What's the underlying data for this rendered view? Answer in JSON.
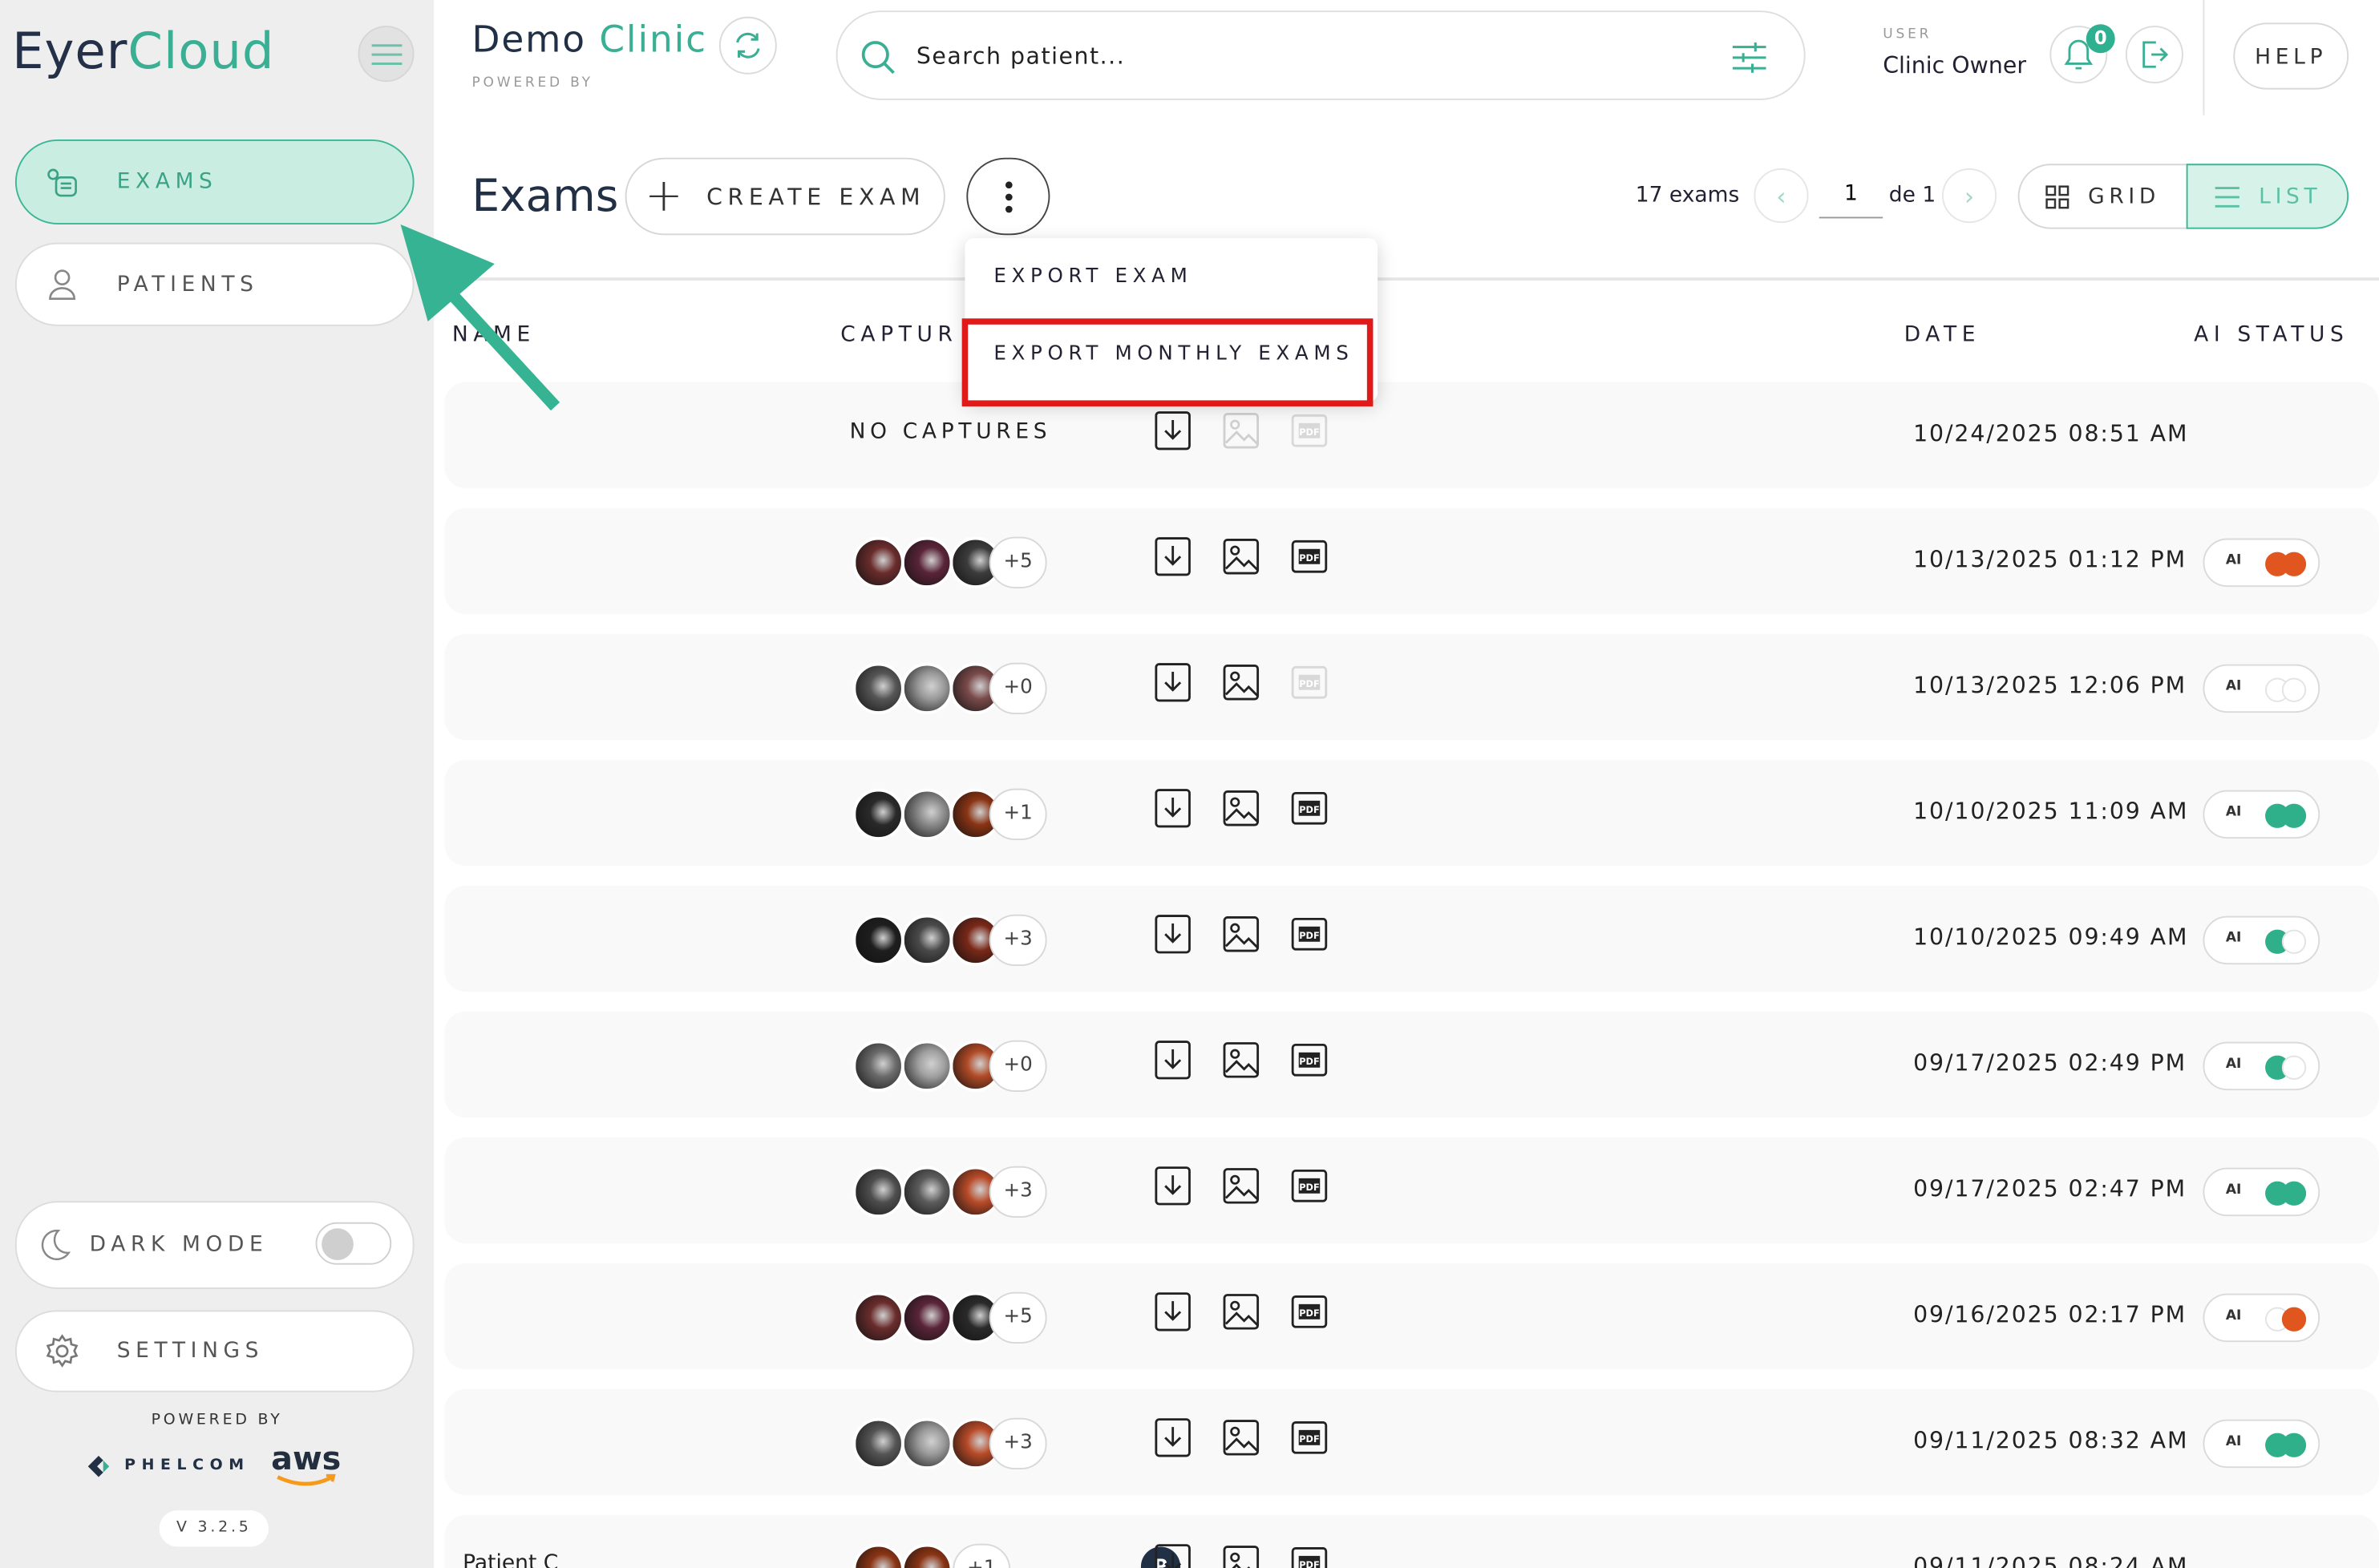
{
  "app": {
    "logo_part1": "Eyer",
    "logo_part2": "Cloud",
    "version": "V 3.2.5",
    "powered_by": "POWERED BY",
    "partner1": "PHELCOM",
    "partner2": "aws"
  },
  "sidebar": {
    "items": [
      {
        "label": "EXAMS",
        "icon": "exams-icon",
        "active": true
      },
      {
        "label": "PATIENTS",
        "icon": "person-icon",
        "active": false
      }
    ],
    "dark_mode_label": "DARK MODE",
    "dark_mode_on": false,
    "settings_label": "SETTINGS"
  },
  "header": {
    "clinic_part1": "Demo",
    "clinic_part2": "Clinic",
    "clinic_sub": "POWERED BY",
    "search_placeholder": "Search patient...",
    "user_label": "USER",
    "user_name": "Clinic Owner",
    "notifications": "0",
    "help_label": "HELP"
  },
  "toolbar": {
    "title": "Exams",
    "create_label": "CREATE EXAM",
    "count_label": "17 exams",
    "page_value": "1",
    "page_of": "de 1",
    "grid_label": "GRID",
    "list_label": "LIST"
  },
  "dropdown": {
    "items": [
      "EXPORT EXAM",
      "EXPORT MONTHLY EXAMS"
    ],
    "highlighted_index": 1
  },
  "table": {
    "headers": {
      "name": "NAME",
      "captures": "CAPTUR",
      "date": "DATE",
      "ai_status": "AI STATUS"
    },
    "rows": [
      {
        "name": "",
        "captures": "NO CAPTURES",
        "extra": "",
        "pdf": false,
        "image": false,
        "date": "10/24/2025 08:51 AM",
        "ai": null
      },
      {
        "name": "",
        "captures": "",
        "extra": "+5",
        "thumbs": [
          "#6a2c2c",
          "#5a2438",
          "#3c3c3c"
        ],
        "pdf": true,
        "image": true,
        "date": "10/13/2025 01:12 PM",
        "ai": {
          "label": "AI",
          "dots": [
            "#e0561e",
            "#e0561e"
          ]
        }
      },
      {
        "name": "",
        "captures": "",
        "extra": "+0",
        "thumbs": [
          "#555555",
          "#9a9a9a",
          "#7a4a4a"
        ],
        "pdf": false,
        "image": true,
        "date": "10/13/2025 12:06 PM",
        "ai": {
          "label": "AI",
          "dots": [
            "none",
            "none"
          ]
        }
      },
      {
        "name": "",
        "captures": "",
        "extra": "+1",
        "thumbs": [
          "#2a2a2a",
          "#8a8a8a",
          "#8a3414"
        ],
        "pdf": true,
        "image": true,
        "date": "10/10/2025 11:09 AM",
        "ai": {
          "label": "AI",
          "dots": [
            "#2fb08a",
            "#2fb08a"
          ]
        }
      },
      {
        "name": "",
        "captures": "",
        "extra": "+3",
        "thumbs": [
          "#1e1e1e",
          "#4a4a4a",
          "#7a2818"
        ],
        "pdf": true,
        "image": true,
        "date": "10/10/2025 09:49 AM",
        "ai": {
          "label": "AI",
          "dots": [
            "#2fb08a",
            "none"
          ]
        }
      },
      {
        "name": "",
        "captures": "",
        "extra": "+0",
        "thumbs": [
          "#6a6a6a",
          "#a0a0a0",
          "#b04a26"
        ],
        "pdf": true,
        "image": true,
        "date": "09/17/2025 02:49 PM",
        "ai": {
          "label": "AI",
          "dots": [
            "#2fb08a",
            "none"
          ]
        }
      },
      {
        "name": "",
        "captures": "",
        "extra": "+3",
        "thumbs": [
          "#4e4e4e",
          "#5c5c5c",
          "#b84a28"
        ],
        "pdf": true,
        "image": true,
        "date": "09/17/2025 02:47 PM",
        "ai": {
          "label": "AI",
          "dots": [
            "#2fb08a",
            "#2fb08a"
          ]
        }
      },
      {
        "name": "",
        "captures": "",
        "extra": "+5",
        "thumbs": [
          "#6a2c2c",
          "#5a2438",
          "#2a2a2a"
        ],
        "pdf": true,
        "image": true,
        "date": "09/16/2025 02:17 PM",
        "ai": {
          "label": "AI",
          "dots": [
            "none",
            "#e0561e"
          ]
        }
      },
      {
        "name": "",
        "captures": "",
        "extra": "+3",
        "thumbs": [
          "#555555",
          "#9a9a9a",
          "#b84a28"
        ],
        "pdf": true,
        "image": true,
        "date": "09/11/2025 08:32 AM",
        "ai": {
          "label": "AI",
          "dots": [
            "#2fb08a",
            "#2fb08a"
          ]
        }
      },
      {
        "name": "Patient C",
        "captures": "",
        "extra": "+1",
        "thumbs": [
          "#8a3414",
          "#8a3414"
        ],
        "pdf": true,
        "image": true,
        "date": "09/11/2025 08:24 AM",
        "ai": null
      }
    ]
  },
  "colors": {
    "accent": "#3aaf94",
    "active_bg": "#c9eee1",
    "highlight_red": "#e01919",
    "annotation_arrow": "#35b393"
  }
}
